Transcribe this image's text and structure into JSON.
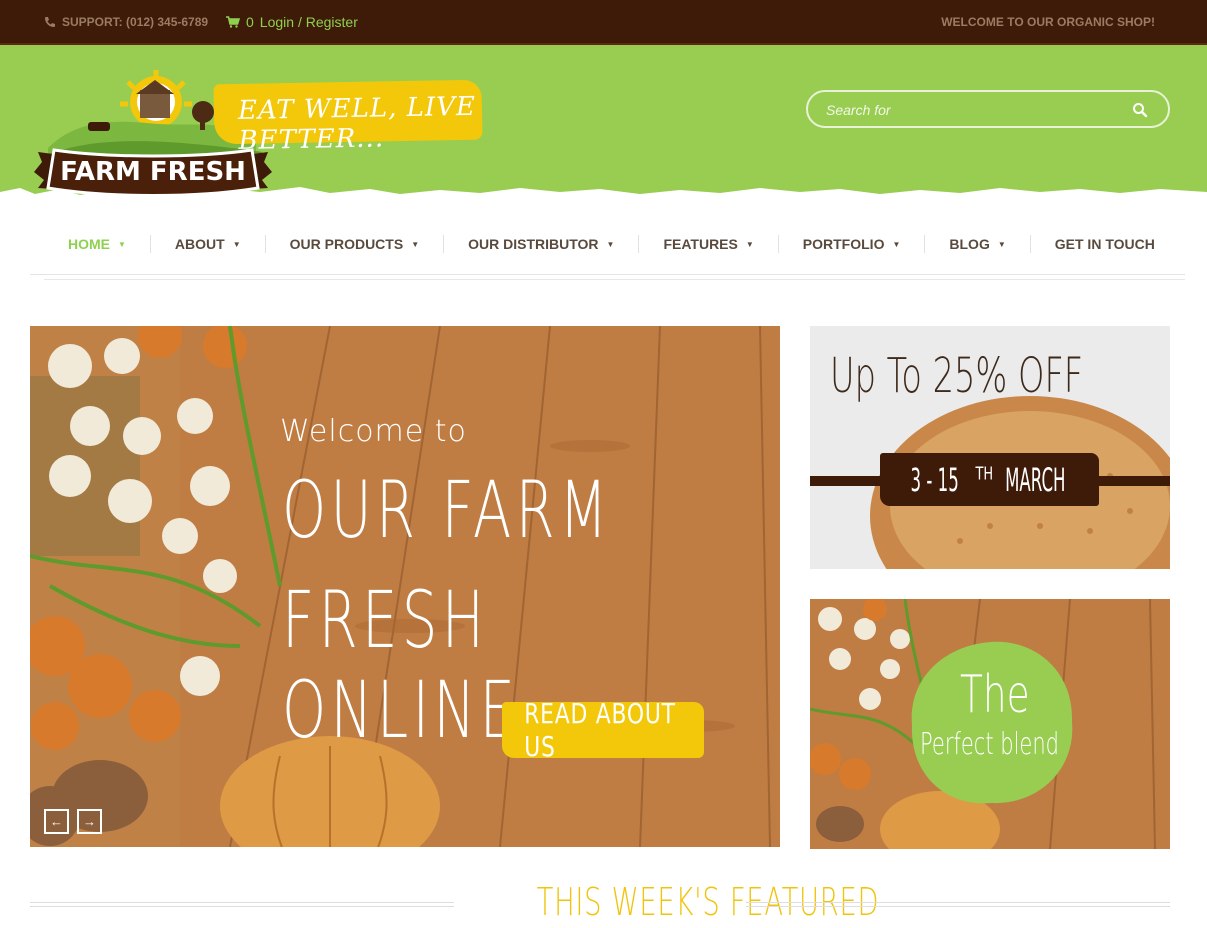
{
  "topbar": {
    "support_text": "SUPPORT: (012) 345-6789",
    "cart_count": "0",
    "login_register": "Login / Register",
    "welcome_text": "WELCOME TO OUR ORGANIC SHOP!"
  },
  "header": {
    "logo_text": "FARM FRESH",
    "tagline": "EAT WELL, LIVE BETTER...",
    "search_placeholder": "Search for"
  },
  "nav": {
    "items": [
      {
        "label": "HOME",
        "active": true
      },
      {
        "label": "ABOUT"
      },
      {
        "label": "OUR PRODUCTS"
      },
      {
        "label": "OUR DISTRIBUTOR"
      },
      {
        "label": "FEATURES"
      },
      {
        "label": "PORTFOLIO"
      },
      {
        "label": "BLOG"
      },
      {
        "label": "GET IN TOUCH"
      }
    ]
  },
  "hero": {
    "welcome_to": "Welcome to",
    "headline_1": "OUR FARM",
    "headline_2": "FRESH ONLINE",
    "cta_label": "READ ABOUT US",
    "prev_arrow": "←",
    "next_arrow": "→"
  },
  "promo_sale": {
    "headline": "Up To 25% OFF",
    "date_range": "3 - 15",
    "date_suffix": "TH",
    "month": "MARCH"
  },
  "promo_blend": {
    "the": "The",
    "subtitle": "Perfect blend"
  },
  "featured": {
    "title": "THIS WEEK'S FEATURED"
  },
  "colors": {
    "topbar_bg": "#3e1a08",
    "header_green": "#98cd52",
    "accent_green": "#8fd14f",
    "accent_yellow": "#f3c70a",
    "dark_brown": "#3e1a08"
  }
}
